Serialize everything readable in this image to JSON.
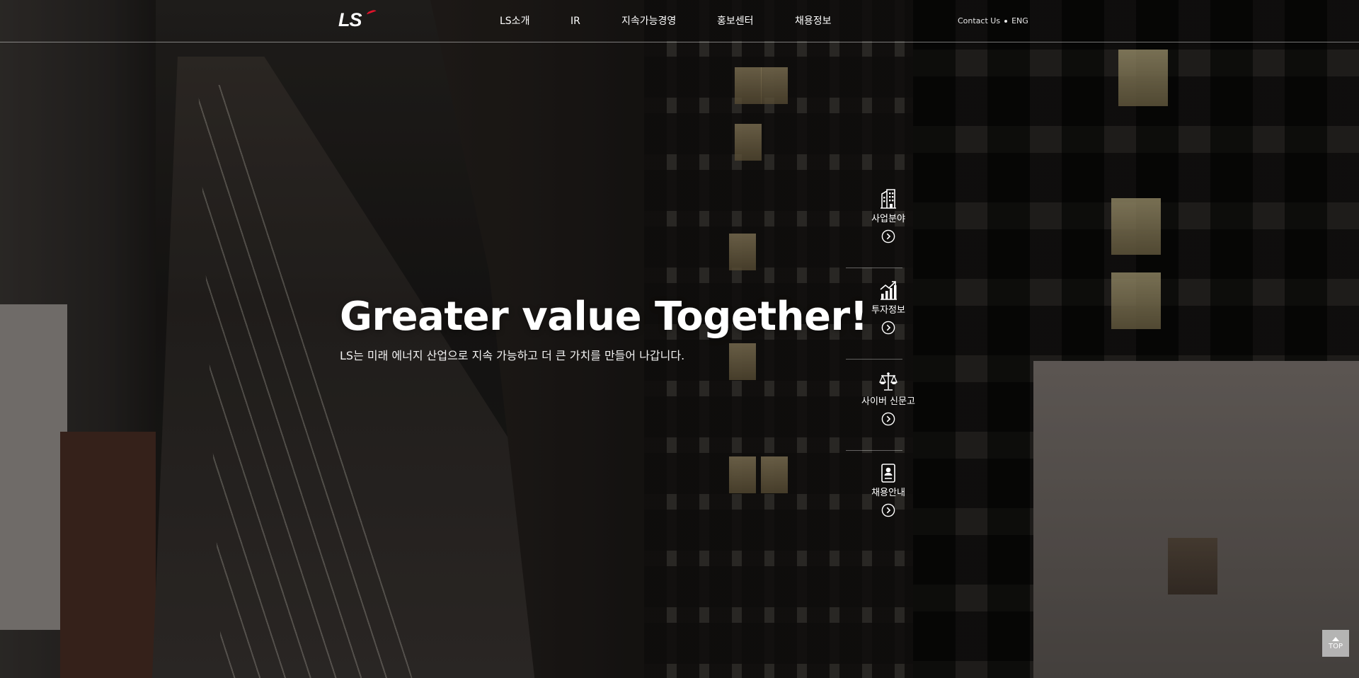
{
  "header": {
    "logo_text": "LS",
    "nav": [
      {
        "label": "LS소개"
      },
      {
        "label": "IR"
      },
      {
        "label": "지속가능경영"
      },
      {
        "label": "홍보센터"
      },
      {
        "label": "채용정보"
      }
    ],
    "utils": {
      "contact": "Contact Us",
      "lang": "ENG"
    }
  },
  "hero": {
    "title": "Greater value Together!",
    "subtitle": "LS는 미래 에너지 산업으로 지속 가능하고 더 큰 가치를 만들어 나갑니다."
  },
  "quick_menu": [
    {
      "label": "사업분야",
      "icon": "building-icon"
    },
    {
      "label": "투자정보",
      "icon": "chart-up-icon"
    },
    {
      "label": "사이버 신문고",
      "icon": "scale-icon"
    },
    {
      "label": "채용안내",
      "icon": "id-card-icon"
    }
  ],
  "top_button": {
    "label": "TOP"
  },
  "colors": {
    "brand_red": "#e0132b",
    "text": "#ffffff"
  }
}
